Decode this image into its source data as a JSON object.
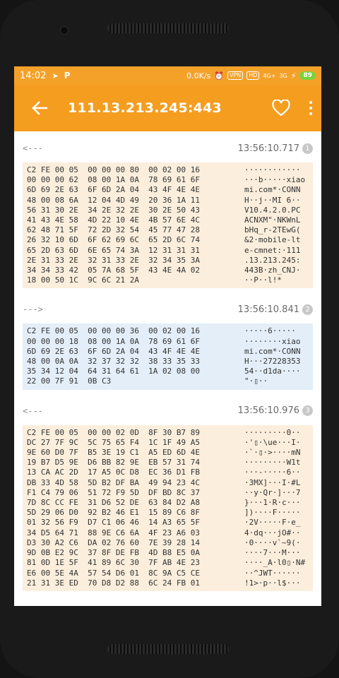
{
  "status": {
    "time": "14:02",
    "speed": "0.0K/s",
    "vpn": "VPN",
    "hd": "HD",
    "net1": "4G+",
    "net2": "3G",
    "battery": "89"
  },
  "appbar": {
    "title": "111.13.213.245:443"
  },
  "packets": [
    {
      "direction": "<---",
      "time": "13:56:10.717",
      "index": "1",
      "type": "in",
      "hex": [
        "C2 FE 00 05  00 00 00 80  00 02 00 16",
        "00 00 00 62  08 00 1A 0A  78 69 61 6F",
        "6D 69 2E 63  6F 6D 2A 04  43 4F 4E 4E",
        "48 00 08 6A  12 04 4D 49  20 36 1A 11",
        "56 31 30 2E  34 2E 32 2E  30 2E 50 43",
        "41 43 4E 58  4D 22 10 4E  4B 57 6E 4C",
        "62 48 71 5F  72 2D 32 54  45 77 47 28",
        "26 32 10 6D  6F 62 69 6C  65 2D 6C 74",
        "65 2D 63 6D  6E 65 74 3A  12 31 31 31",
        "2E 31 33 2E  32 31 33 2E  32 34 35 3A",
        "34 34 33 42  05 7A 68 5F  43 4E 4A 02",
        "18 00 50 1C  9C 6C 21 2A"
      ],
      "ascii": [
        "············",
        "···b·····xiao",
        "mi.com*·CONN",
        "H··j··MI 6··",
        "V10.4.2.0.PC",
        "ACNXM\"·NKWnL",
        "bHq_r-2TEwG(",
        "&2·mobile-lt",
        "e-cmnet:·111",
        ".13.213.245:",
        "443B·zh_CNJ·",
        "··P··l!*"
      ]
    },
    {
      "direction": "--->",
      "time": "13:56:10.841",
      "index": "2",
      "type": "out",
      "hex": [
        "C2 FE 00 05  00 00 00 36  00 02 00 16",
        "00 00 00 18  08 00 1A 0A  78 69 61 6F",
        "6D 69 2E 63  6F 6D 2A 04  43 4F 4E 4E",
        "48 00 0A 0A  32 37 32 32  38 33 35 33",
        "35 34 12 04  64 31 64 61  1A 02 08 00",
        "22 00 7F 91  0B C3"
      ],
      "ascii": [
        "·····6·····",
        "········xiao",
        "mi.com*·CONN",
        "H···27228353",
        "54··d1da····",
        "\"·▯··"
      ]
    },
    {
      "direction": "<---",
      "time": "13:56:10.976",
      "index": "3",
      "type": "in",
      "hex": [
        "C2 FE 00 05  00 00 02 0D  8F 30 B7 89",
        "DC 27 7F 9C  5C 75 65 F4  1C 1F 49 A5",
        "9E 60 D0 7F  B5 3E 19 C1  A5 ED 6D 4E",
        "19 B7 D5 9E  D6 BB 82 9E  EB 57 31 74",
        "13 CA AC 2D  17 A5 0C D8  EC 36 D1 FB",
        "DB 33 4D 58  5D B2 DF BA  49 94 23 4C",
        "F1 C4 79 06  51 72 F9 5D  DF BD 8C 37",
        "7D 8C CC FE  31 D6 52 DE  63 84 D2 A8",
        "5D 29 06 D0  92 B2 46 E1  15 89 C6 8F",
        "01 32 56 F9  D7 C1 06 46  14 A3 65 5F",
        "34 D5 64 71  88 9E C6 6A  4F 23 A6 03",
        "D3 30 A2 C6  DA 02 76 60  7E 39 28 14",
        "9D 0B E2 9C  37 8F DE FB  4D B8 E5 0A",
        "81 0D 1E 5F  41 89 6C 30  7F AB 4E 23",
        "E6 00 5E 4A  57 54 D6 01  8C 9A C5 CE",
        "21 31 3E ED  70 D8 D2 88  6C 24 FB 01"
      ],
      "ascii": [
        "·········0··",
        "·'▯·\\ue···I·",
        "·`·▯·>····mN",
        "·········W1t",
        "···-·····6··",
        "·3MX]···I·#L",
        "··y·Qr·]···7",
        "}···1·R·c···",
        "])····F·····",
        "·2V·····F·e_",
        "4·dq···jO#··",
        "·0····v`~9(·",
        "····7···M···",
        "····_A·l0▯·N#",
        "··^JWT······",
        "!1>·p··l$···"
      ]
    }
  ]
}
